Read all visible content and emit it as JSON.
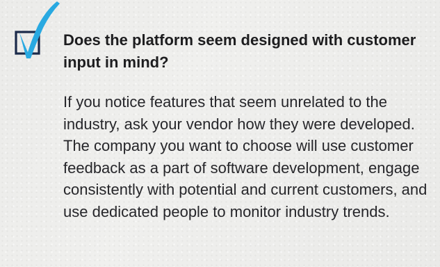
{
  "question": "Does the platform seem designed with customer input in mind?",
  "answer": "If you notice features that seem unrelated to the industry, ask your vendor how they were developed. The company you want to choose will use customer feedback as a part of software development, engage consistently with potential and current customers, and use dedicated people to monitor industry trends.",
  "colors": {
    "checkmark": "#29a9e1",
    "checkbox_border": "#1b2a4a",
    "text": "#1d1d1f"
  },
  "icon": "checked-box-icon"
}
